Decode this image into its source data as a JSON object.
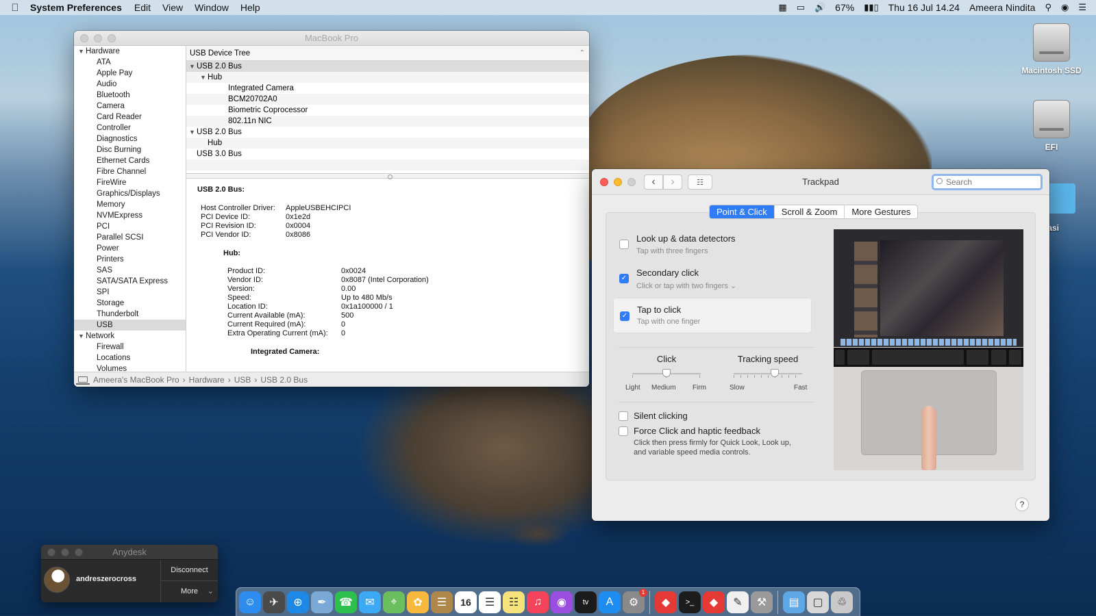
{
  "menubar": {
    "app_name": "System Preferences",
    "menus": [
      "Edit",
      "View",
      "Window",
      "Help"
    ],
    "battery": "67%",
    "datetime": "Thu 16 Jul  14.24",
    "user": "Ameera Nindita"
  },
  "desktop": {
    "icons": [
      {
        "label": "Macintosh SSD",
        "icon": "drive-icon"
      },
      {
        "label": "EFI",
        "icon": "drive-icon"
      },
      {
        "label": "nentasi",
        "icon": "folder-icon"
      }
    ]
  },
  "sysinfo": {
    "title": "MacBook Pro",
    "sidebar": {
      "hardware_label": "Hardware",
      "hardware_items": [
        "ATA",
        "Apple Pay",
        "Audio",
        "Bluetooth",
        "Camera",
        "Card Reader",
        "Controller",
        "Diagnostics",
        "Disc Burning",
        "Ethernet Cards",
        "Fibre Channel",
        "FireWire",
        "Graphics/Displays",
        "Memory",
        "NVMExpress",
        "PCI",
        "Parallel SCSI",
        "Power",
        "Printers",
        "SAS",
        "SATA/SATA Express",
        "SPI",
        "Storage",
        "Thunderbolt",
        "USB"
      ],
      "selected": "USB",
      "network_label": "Network",
      "network_items": [
        "Firewall",
        "Locations",
        "Volumes"
      ]
    },
    "tree_header": "USB Device Tree",
    "tree": [
      {
        "label": "USB 2.0 Bus",
        "level": 0,
        "expanded": true
      },
      {
        "label": "Hub",
        "level": 1,
        "expanded": true
      },
      {
        "label": "Integrated Camera",
        "level": 2
      },
      {
        "label": "BCM20702A0",
        "level": 2
      },
      {
        "label": "Biometric Coprocessor",
        "level": 2
      },
      {
        "label": "802.11n NIC",
        "level": 2
      },
      {
        "label": "USB 2.0 Bus",
        "level": 0,
        "expanded": true
      },
      {
        "label": "Hub",
        "level": 1
      },
      {
        "label": "USB 3.0 Bus",
        "level": 0
      }
    ],
    "detail": {
      "title": "USB 2.0 Bus:",
      "bus_props": [
        [
          "Host Controller Driver:",
          "AppleUSBEHCIPCI"
        ],
        [
          "PCI Device ID:",
          "0x1e2d"
        ],
        [
          "PCI Revision ID:",
          "0x0004"
        ],
        [
          "PCI Vendor ID:",
          "0x8086"
        ]
      ],
      "hub_title": "Hub:",
      "hub_props": [
        [
          "Product ID:",
          "0x0024"
        ],
        [
          "Vendor ID:",
          "0x8087  (Intel Corporation)"
        ],
        [
          "Version:",
          "0.00"
        ],
        [
          "Speed:",
          "Up to 480 Mb/s"
        ],
        [
          "Location ID:",
          "0x1a100000 / 1"
        ],
        [
          "Current Available (mA):",
          "500"
        ],
        [
          "Current Required (mA):",
          "0"
        ],
        [
          "Extra Operating Current (mA):",
          "0"
        ]
      ],
      "camera_title": "Integrated Camera:"
    },
    "path": [
      "Ameera's MacBook Pro",
      "Hardware",
      "USB",
      "USB 2.0 Bus"
    ]
  },
  "trackpad": {
    "title": "Trackpad",
    "search_placeholder": "Search",
    "tabs": [
      "Point & Click",
      "Scroll & Zoom",
      "More Gestures"
    ],
    "active_tab": "Point & Click",
    "options": [
      {
        "label": "Look up & data detectors",
        "sub": "Tap with three fingers",
        "checked": false
      },
      {
        "label": "Secondary click",
        "sub": "Click or tap with two fingers",
        "checked": true
      },
      {
        "label": "Tap to click",
        "sub": "Tap with one finger",
        "checked": true
      }
    ],
    "click_slider": {
      "title": "Click",
      "labels": [
        "Light",
        "Medium",
        "Firm"
      ],
      "value": "Medium"
    },
    "speed_slider": {
      "title": "Tracking speed",
      "labels": [
        "Slow",
        "Fast"
      ],
      "value": 0.6
    },
    "silent": {
      "label": "Silent clicking",
      "checked": false
    },
    "force": {
      "label": "Force Click and haptic feedback",
      "sub1": "Click then press firmly for Quick Look, Look up,",
      "sub2": "and variable speed media controls.",
      "checked": false
    },
    "help": "?"
  },
  "anydesk": {
    "title": "Anydesk",
    "user": "andreszerocross",
    "disconnect": "Disconnect",
    "more": "More"
  },
  "dock": {
    "apps": [
      "finder-icon",
      "launchpad-icon",
      "safari-icon",
      "preview-icon",
      "facetime-icon",
      "messages-icon",
      "maps-icon",
      "photos-icon",
      "notes-book-icon",
      "calendar-icon",
      "reminders-icon",
      "stickies-icon",
      "music-icon",
      "podcasts-icon",
      "tv-icon",
      "appstore-icon",
      "system-preferences-icon",
      "anydesk-icon",
      "terminal-icon",
      "anydesk2-icon",
      "textedit-icon",
      "automator-icon",
      "downloads-folder-icon",
      "screenshot-icon",
      "trash-icon"
    ],
    "calendar_day": "16"
  }
}
